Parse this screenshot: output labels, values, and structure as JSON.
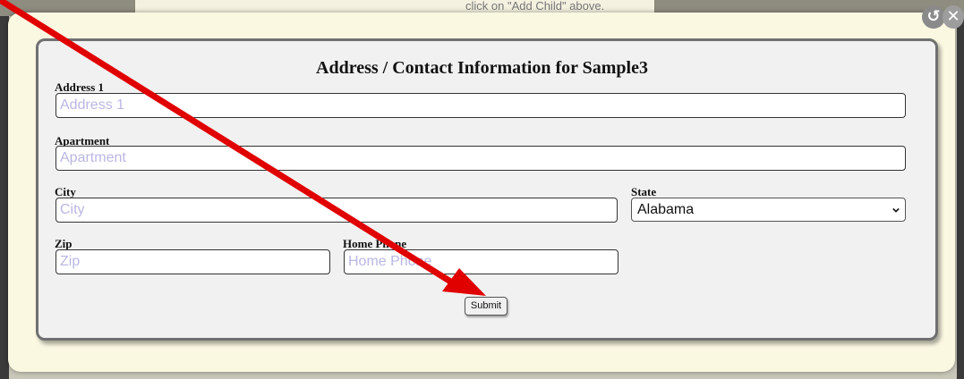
{
  "background": {
    "top_text": "click on \"Add Child\" above."
  },
  "dialog": {
    "refresh_icon_glyph": "↺",
    "close_icon_glyph": "✕",
    "title": "Address / Contact Information for Sample3"
  },
  "form": {
    "address1": {
      "label": "Address 1",
      "placeholder": "Address 1",
      "value": ""
    },
    "apartment": {
      "label": "Apartment",
      "placeholder": "Apartment",
      "value": ""
    },
    "city": {
      "label": "City",
      "placeholder": "City",
      "value": ""
    },
    "state": {
      "label": "State",
      "selected": "Alabama"
    },
    "zip": {
      "label": "Zip",
      "placeholder": "Zip",
      "value": ""
    },
    "home_phone": {
      "label": "Home Phone",
      "placeholder": "Home Phone",
      "value": ""
    },
    "submit_label": "Submit"
  },
  "colors": {
    "dialog_bg": "#fbf8e2",
    "panel_bg": "#f1f1f1",
    "placeholder": "#b9b7e4",
    "annotation_arrow": "#e00000"
  },
  "icons": {
    "refresh": "refresh-icon",
    "close": "close-icon",
    "dropdown": "chevron-down-icon"
  }
}
